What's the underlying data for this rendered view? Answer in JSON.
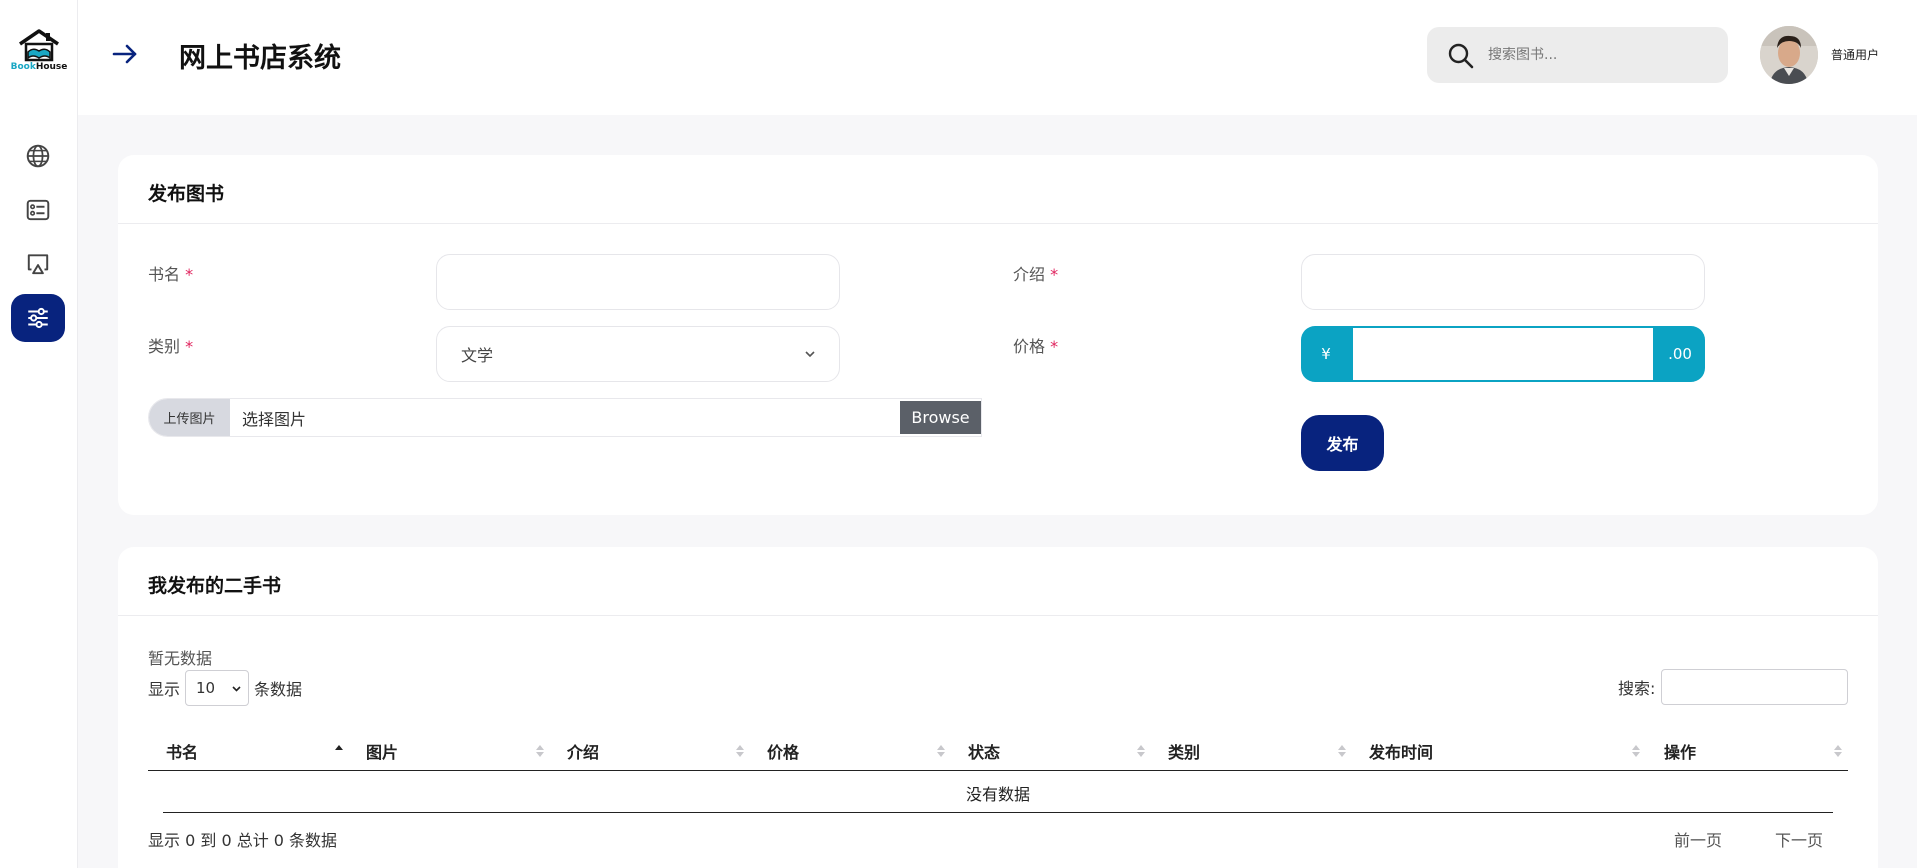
{
  "app": {
    "logo_text_a": "Book",
    "logo_text_b": "House",
    "title": "网上书店系统"
  },
  "sidebar": {
    "items": [
      {
        "icon": "globe-icon"
      },
      {
        "icon": "list-card-icon"
      },
      {
        "icon": "presentation-icon"
      },
      {
        "icon": "sliders-icon",
        "active": true
      }
    ]
  },
  "header": {
    "search_placeholder": "搜索图书...",
    "user_name": "普通用户"
  },
  "publish_form": {
    "title": "发布图书",
    "name_label": "书名",
    "intro_label": "介绍",
    "category_label": "类别",
    "category_value": "文学",
    "price_label": "价格",
    "price_prefix": "¥",
    "price_suffix": ".00",
    "required_mark": "*",
    "upload_label": "上传图片",
    "upload_text": "选择图片",
    "browse_label": "Browse",
    "submit_label": "发布"
  },
  "my_books": {
    "title": "我发布的二手书",
    "empty_notice": "暂无数据",
    "show_prefix": "显示",
    "page_length": "10",
    "show_suffix": "条数据",
    "search_label": "搜索:",
    "columns": [
      "书名",
      "图片",
      "介绍",
      "价格",
      "状态",
      "类别",
      "发布时间",
      "操作"
    ],
    "empty_row": "没有数据",
    "info": "显示 0 到 0 总计 0 条数据",
    "prev_label": "前一页",
    "next_label": "下一页"
  },
  "colors": {
    "accent": "#08237e",
    "teal": "#0ba3c3",
    "required": "#e0245e"
  }
}
